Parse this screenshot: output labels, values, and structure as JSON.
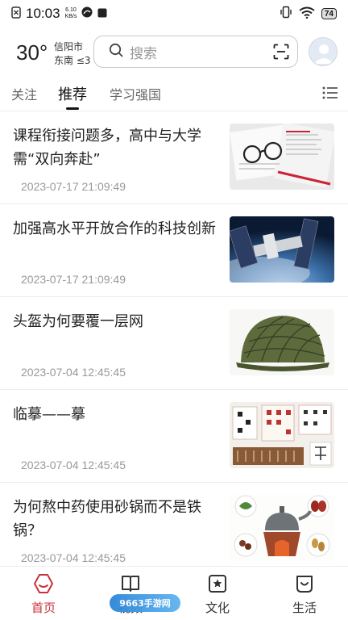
{
  "status_bar": {
    "time": "10:03",
    "speed_value": "6.10",
    "speed_unit": "KB/s",
    "battery": "74",
    "icons": [
      "sim-icon",
      "alert-icon",
      "notification-icon",
      "vibrate-icon",
      "wifi-icon",
      "battery-icon"
    ]
  },
  "header": {
    "temperature": "30°",
    "city": "信阳市",
    "wind": "东南 ≤3",
    "search_placeholder": "搜索"
  },
  "tabs": [
    {
      "label": "关注",
      "active": false
    },
    {
      "label": "推荐",
      "active": true
    },
    {
      "label": "学习强国",
      "active": false
    }
  ],
  "articles": [
    {
      "title": "课程衔接问题多，高中与大学需“双向奔赴”",
      "date": "2023-07-17 21:09:49",
      "thumb": "papers-glasses"
    },
    {
      "title": "加强高水平开放合作的科技创新",
      "date": "2023-07-17 21:09:49",
      "thumb": "space-station"
    },
    {
      "title": "头盔为何要覆一层网",
      "date": "2023-07-04 12:45:45",
      "thumb": "helmet-net"
    },
    {
      "title": "临摹——摹",
      "date": "2023-07-04 12:45:45",
      "thumb": "calligraphy"
    },
    {
      "title": "为何熬中药使用砂锅而不是铁锅？",
      "date": "2023-07-04 12:45:45",
      "thumb": "herbal-pot"
    }
  ],
  "bottom_nav": [
    {
      "label": "首页",
      "icon": "home-icon",
      "active": true
    },
    {
      "label": "视频",
      "icon": "book-icon",
      "active": false
    },
    {
      "label": "文化",
      "icon": "star-square-icon",
      "active": false
    },
    {
      "label": "生活",
      "icon": "smile-bag-icon",
      "active": false
    }
  ],
  "watermark": "9663手游网",
  "colors": {
    "accent": "#c8323c",
    "text": "#222222",
    "muted": "#999999"
  }
}
